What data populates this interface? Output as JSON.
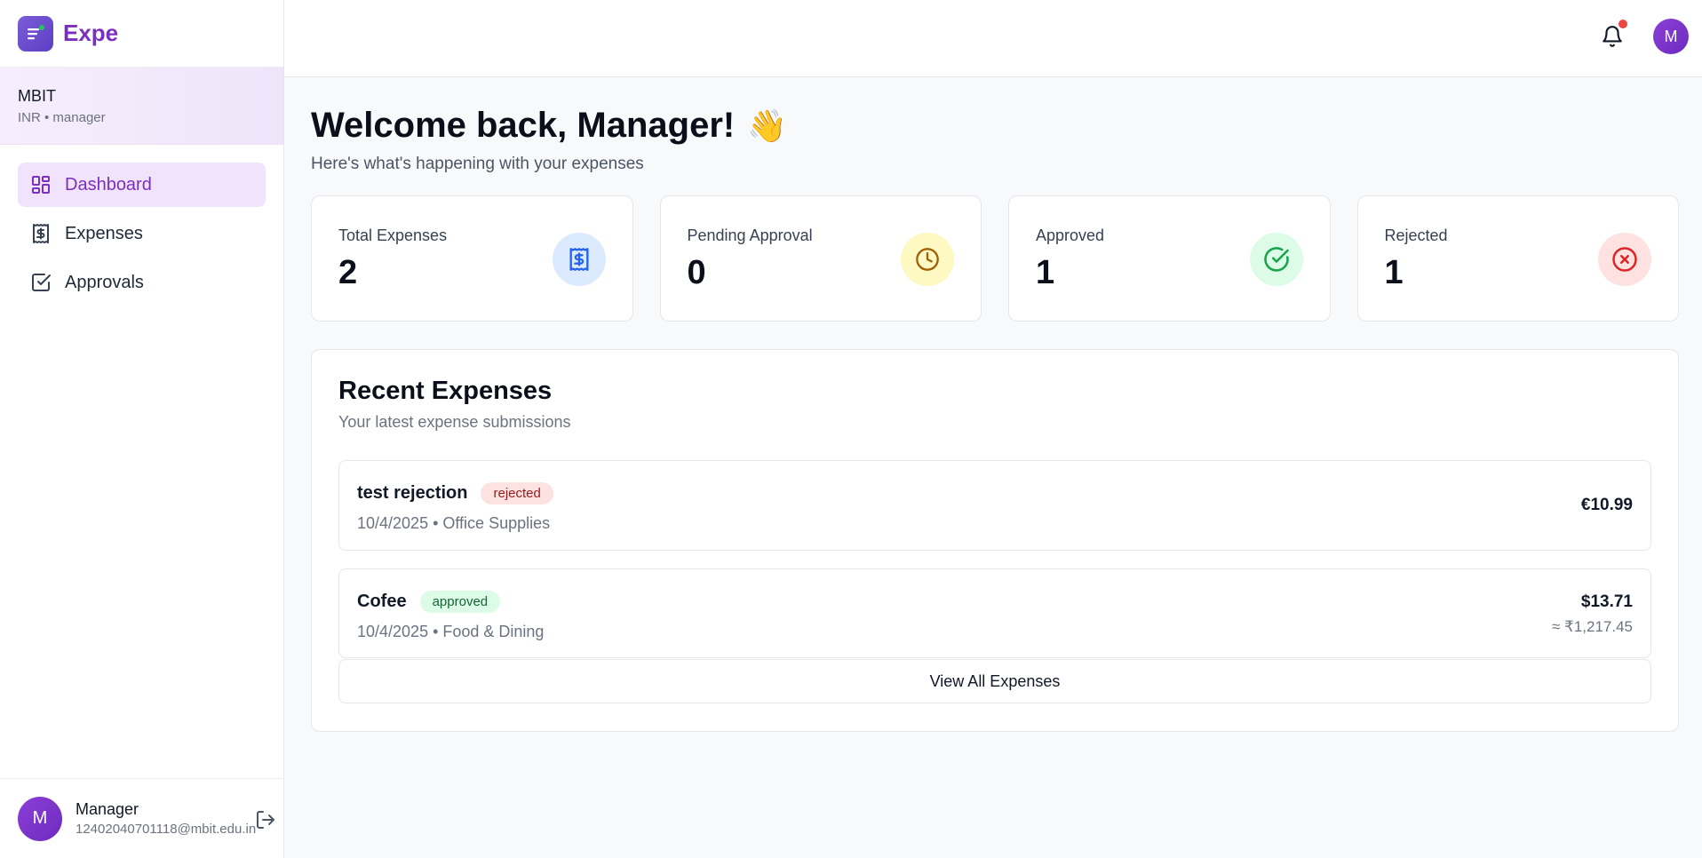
{
  "brand": {
    "name": "Expe"
  },
  "org": {
    "name": "MBIT",
    "sub": "INR • manager"
  },
  "nav": [
    {
      "label": "Dashboard",
      "icon": "dashboard-icon",
      "active": true
    },
    {
      "label": "Expenses",
      "icon": "receipt-icon",
      "active": false
    },
    {
      "label": "Approvals",
      "icon": "check-square-icon",
      "active": false
    }
  ],
  "user": {
    "initial": "M",
    "name": "Manager",
    "email": "12402040701118@mbit.edu.in"
  },
  "topbar": {
    "avatar_initial": "M",
    "has_notification": true
  },
  "welcome": {
    "title": "Welcome back, Manager!",
    "emoji": "👋",
    "subtitle": "Here's what's happening with your expenses"
  },
  "stats": [
    {
      "label": "Total Expenses",
      "value": "2",
      "icon": "receipt-icon",
      "color": "#2563eb",
      "bg": "#dbeafe"
    },
    {
      "label": "Pending Approval",
      "value": "0",
      "icon": "clock-icon",
      "color": "#a16207",
      "bg": "#fef9c3"
    },
    {
      "label": "Approved",
      "value": "1",
      "icon": "check-circle-icon",
      "color": "#16a34a",
      "bg": "#dcfce7"
    },
    {
      "label": "Rejected",
      "value": "1",
      "icon": "x-circle-icon",
      "color": "#dc2626",
      "bg": "#fee2e2"
    }
  ],
  "recent": {
    "title": "Recent Expenses",
    "subtitle": "Your latest expense submissions",
    "items": [
      {
        "name": "test rejection",
        "status": "rejected",
        "meta": "10/4/2025 • Office Supplies",
        "amount": "€10.99",
        "converted": ""
      },
      {
        "name": "Cofee",
        "status": "approved",
        "meta": "10/4/2025 • Food & Dining",
        "amount": "$13.71",
        "converted": "≈ ₹1,217.45"
      }
    ],
    "view_all": "View All Expenses"
  }
}
